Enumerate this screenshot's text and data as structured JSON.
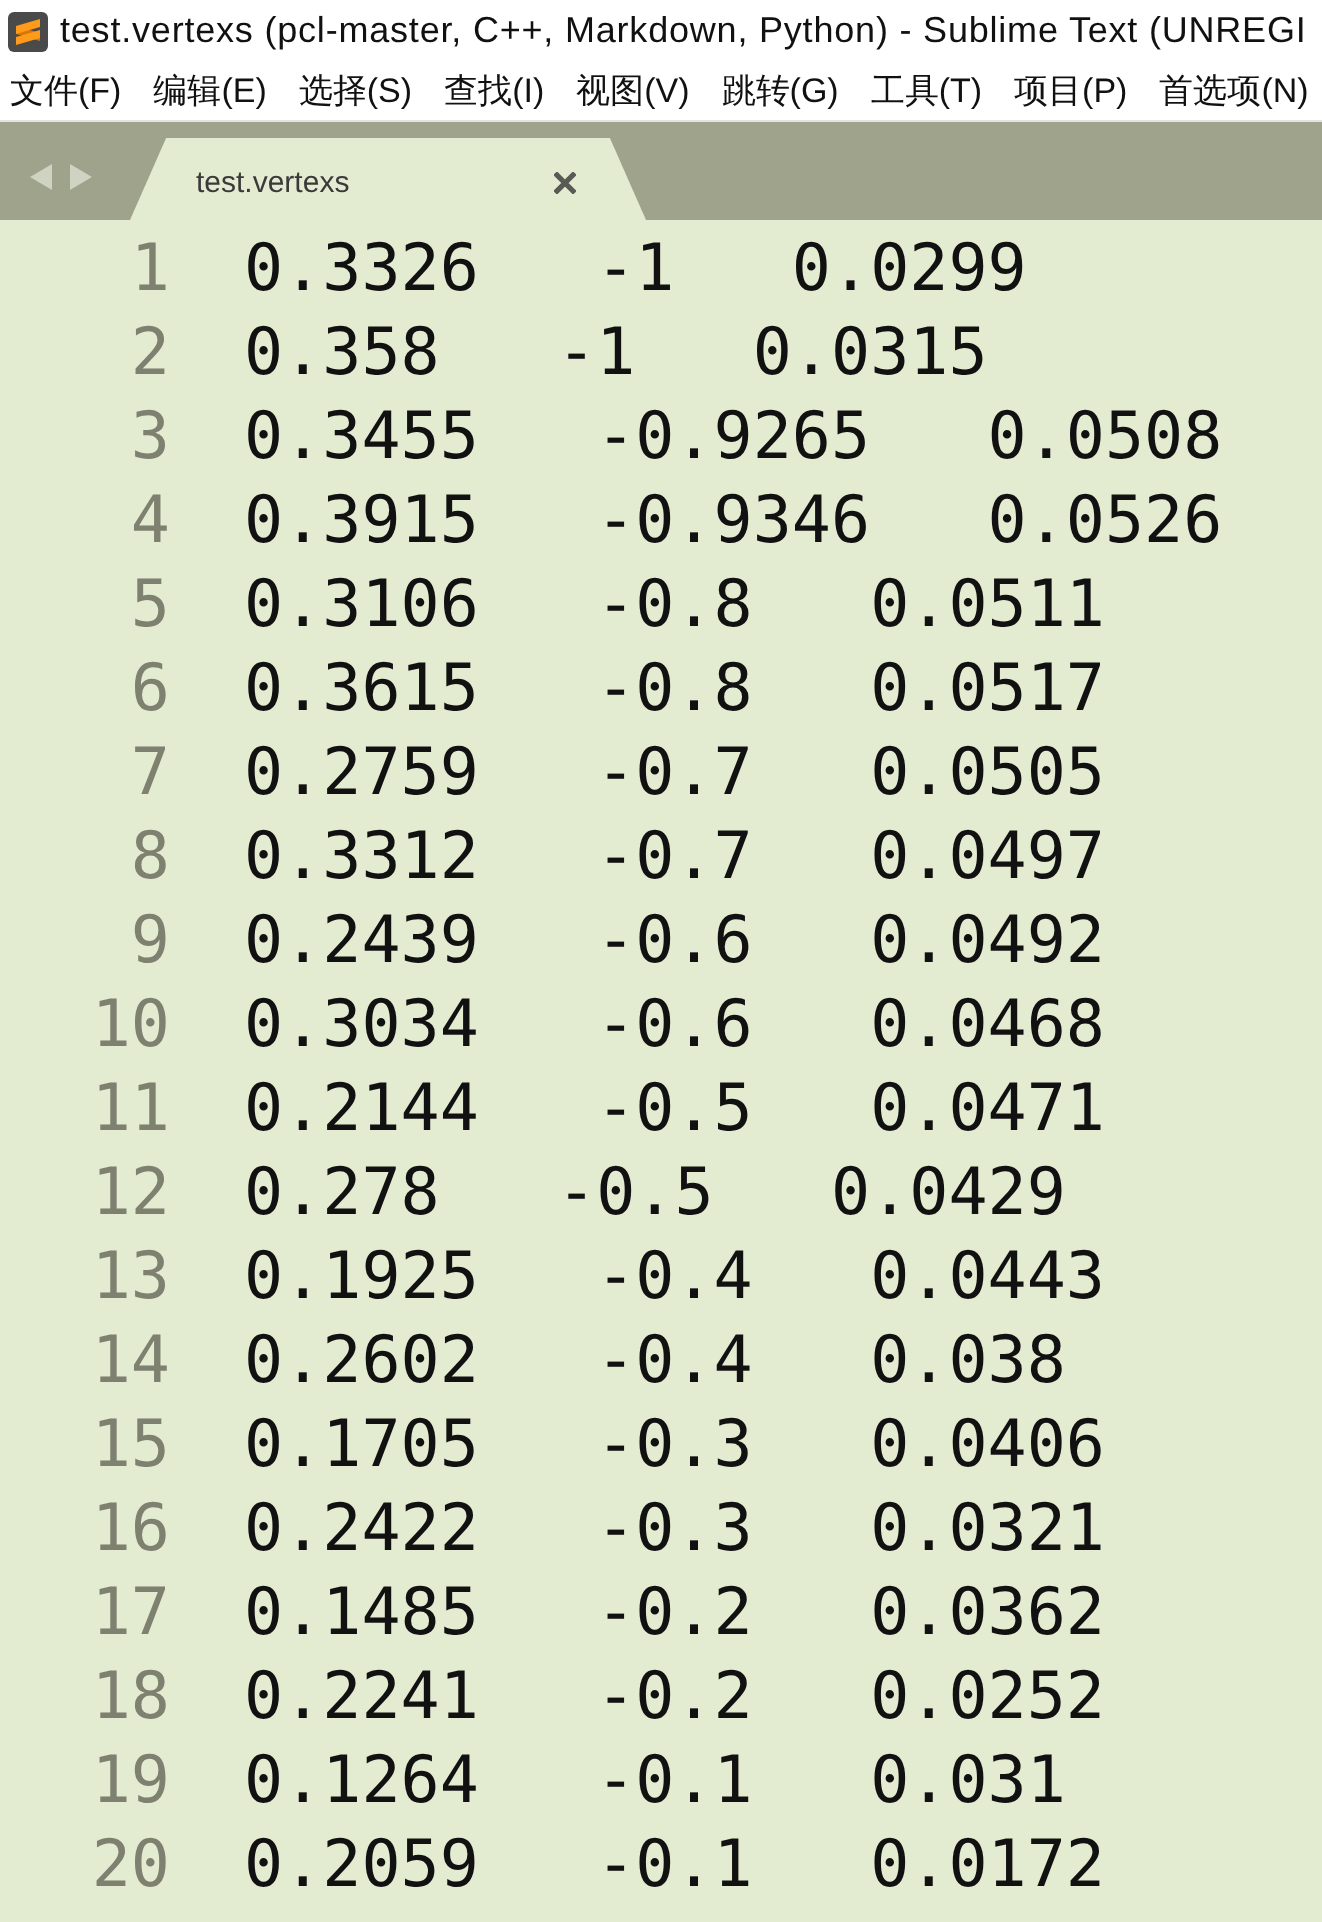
{
  "window": {
    "title": "test.vertexs (pcl-master, C++, Markdown, Python) - Sublime Text (UNREGI"
  },
  "menu": [
    "文件(F)",
    "编辑(E)",
    "选择(S)",
    "查找(I)",
    "视图(V)",
    "跳转(G)",
    "工具(T)",
    "项目(P)",
    "首选项(N)"
  ],
  "tabs": [
    {
      "label": "test.vertexs",
      "selected": true
    }
  ],
  "editor": {
    "lines": [
      {
        "number": "1",
        "text": "0.3326   -1   0.0299"
      },
      {
        "number": "2",
        "text": "0.358   -1   0.0315"
      },
      {
        "number": "3",
        "text": "0.3455   -0.9265   0.0508"
      },
      {
        "number": "4",
        "text": "0.3915   -0.9346   0.0526"
      },
      {
        "number": "5",
        "text": "0.3106   -0.8   0.0511"
      },
      {
        "number": "6",
        "text": "0.3615   -0.8   0.0517"
      },
      {
        "number": "7",
        "text": "0.2759   -0.7   0.0505"
      },
      {
        "number": "8",
        "text": "0.3312   -0.7   0.0497"
      },
      {
        "number": "9",
        "text": "0.2439   -0.6   0.0492"
      },
      {
        "number": "10",
        "text": "0.3034   -0.6   0.0468"
      },
      {
        "number": "11",
        "text": "0.2144   -0.5   0.0471"
      },
      {
        "number": "12",
        "text": "0.278   -0.5   0.0429"
      },
      {
        "number": "13",
        "text": "0.1925   -0.4   0.0443"
      },
      {
        "number": "14",
        "text": "0.2602   -0.4   0.038"
      },
      {
        "number": "15",
        "text": "0.1705   -0.3   0.0406"
      },
      {
        "number": "16",
        "text": "0.2422   -0.3   0.0321"
      },
      {
        "number": "17",
        "text": "0.1485   -0.2   0.0362"
      },
      {
        "number": "18",
        "text": "0.2241   -0.2   0.0252"
      },
      {
        "number": "19",
        "text": "0.1264   -0.1   0.031"
      },
      {
        "number": "20",
        "text": "0.2059   -0.1   0.0172"
      }
    ]
  }
}
